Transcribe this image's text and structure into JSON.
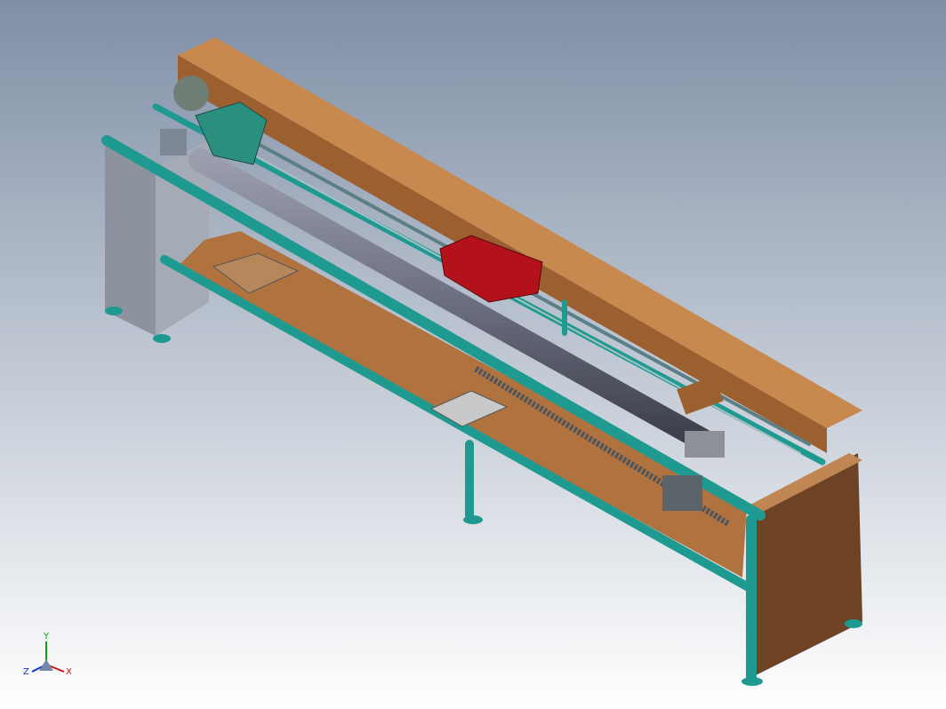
{
  "viewport": {
    "background_top": "#7f8fa6",
    "background_bottom": "#ffffff"
  },
  "model": {
    "frame_color": "#1f9a90",
    "panel_color": "#b0723f",
    "shaft_color": "#6b6f80",
    "carriage_color": "#b3121a",
    "motor_color": "#6e7e75",
    "cabinet_color": "#8c929e"
  },
  "triad": {
    "x_label": "X",
    "y_label": "Y",
    "z_label": "Z",
    "x_color": "#d01010",
    "y_color": "#10a010",
    "z_color": "#1030c0"
  }
}
